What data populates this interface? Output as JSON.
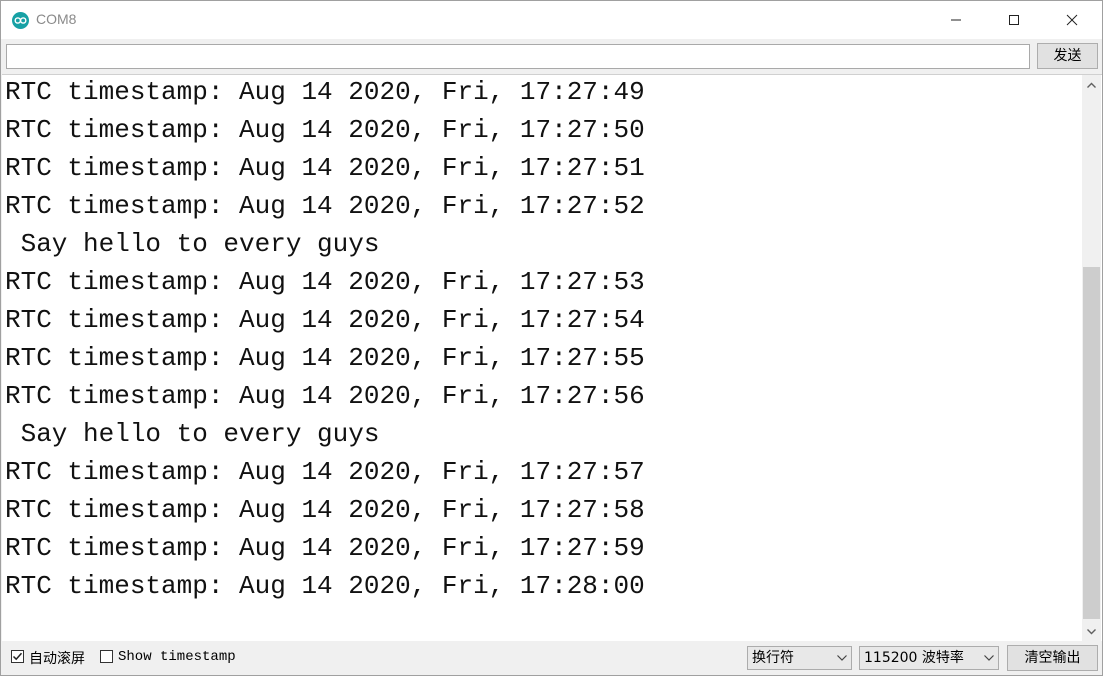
{
  "window": {
    "title": "COM8"
  },
  "send_bar": {
    "input_value": "",
    "send_label": "发送"
  },
  "output": {
    "lines": [
      "RTC timestamp: Aug 14 2020, Fri, 17:27:49",
      "RTC timestamp: Aug 14 2020, Fri, 17:27:50",
      "RTC timestamp: Aug 14 2020, Fri, 17:27:51",
      "RTC timestamp: Aug 14 2020, Fri, 17:27:52",
      " Say hello to every guys",
      "RTC timestamp: Aug 14 2020, Fri, 17:27:53",
      "RTC timestamp: Aug 14 2020, Fri, 17:27:54",
      "RTC timestamp: Aug 14 2020, Fri, 17:27:55",
      "RTC timestamp: Aug 14 2020, Fri, 17:27:56",
      " Say hello to every guys",
      "RTC timestamp: Aug 14 2020, Fri, 17:27:57",
      "RTC timestamp: Aug 14 2020, Fri, 17:27:58",
      "RTC timestamp: Aug 14 2020, Fri, 17:27:59",
      "RTC timestamp: Aug 14 2020, Fri, 17:28:00"
    ]
  },
  "footer": {
    "autoscroll": {
      "label": "自动滚屏",
      "checked": true
    },
    "show_timestamp": {
      "label": "Show timestamp",
      "checked": false
    },
    "line_ending": {
      "selected": "换行符"
    },
    "baud_rate": {
      "selected": "115200 波特率"
    },
    "clear_label": "清空输出"
  },
  "icons": {
    "app": "arduino-icon",
    "minimize": "minimize-icon",
    "maximize": "maximize-icon",
    "close": "close-icon",
    "scroll_up": "scroll-up-arrow-icon",
    "scroll_down": "scroll-down-arrow-icon",
    "dropdown": "chevron-down-icon",
    "check": "checkmark-icon"
  },
  "colors": {
    "accent": "#17a1a5"
  }
}
